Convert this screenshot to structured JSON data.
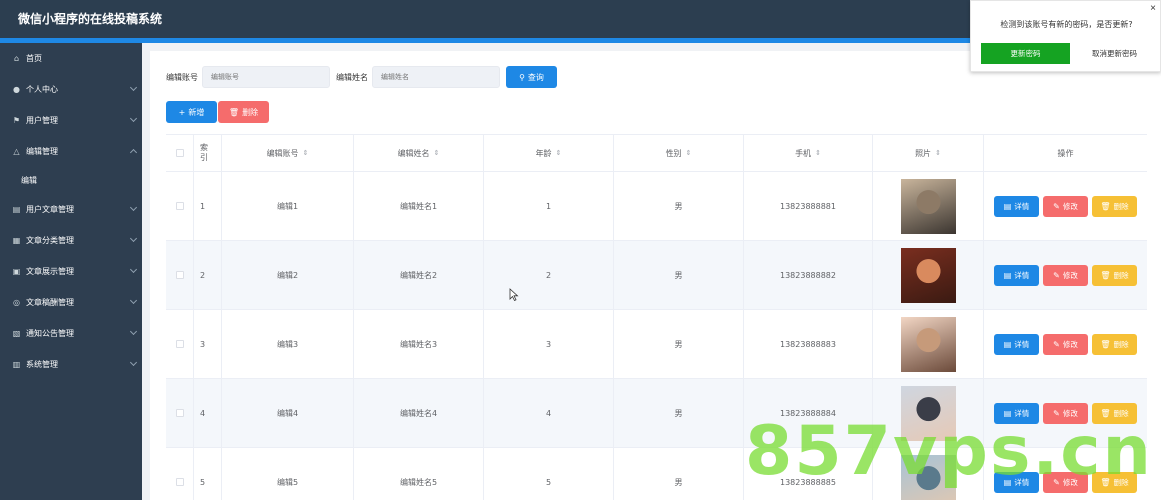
{
  "app": {
    "title": "微信小程序的在线投稿系统"
  },
  "sidebar": {
    "items": [
      {
        "label": "首页",
        "icon": "home-icon",
        "glyph": "⌂",
        "has_arrow": false
      },
      {
        "label": "个人中心",
        "icon": "user-icon",
        "glyph": "●",
        "has_arrow": true
      },
      {
        "label": "用户管理",
        "icon": "flag-icon",
        "glyph": "⚑",
        "has_arrow": true
      },
      {
        "label": "编辑管理",
        "icon": "bell-icon",
        "glyph": "△",
        "has_arrow": true,
        "expanded": true,
        "children": [
          "编辑"
        ]
      },
      {
        "label": "用户文章管理",
        "icon": "document-icon",
        "glyph": "▤",
        "has_arrow": true
      },
      {
        "label": "文章分类管理",
        "icon": "grid-icon",
        "glyph": "▦",
        "has_arrow": true
      },
      {
        "label": "文章展示管理",
        "icon": "media-icon",
        "glyph": "▣",
        "has_arrow": true
      },
      {
        "label": "文章稿酬管理",
        "icon": "microphone-icon",
        "glyph": "◎",
        "has_arrow": true
      },
      {
        "label": "通知公告管理",
        "icon": "message-icon",
        "glyph": "▧",
        "has_arrow": true
      },
      {
        "label": "系统管理",
        "icon": "building-icon",
        "glyph": "▥",
        "has_arrow": true
      }
    ]
  },
  "search": {
    "account_label": "编辑账号",
    "account_placeholder": "编辑账号",
    "name_label": "编辑姓名",
    "name_placeholder": "编辑姓名",
    "query_button": "查询"
  },
  "toolbar": {
    "add_button": "新增",
    "delete_button": "删除"
  },
  "table": {
    "headers": {
      "index": "索引",
      "account": "编辑账号",
      "name": "编辑姓名",
      "age": "年龄",
      "sex": "性别",
      "phone": "手机",
      "photo": "照片",
      "actions": "操作"
    },
    "action_labels": {
      "detail": "详情",
      "edit": "修改",
      "delete": "删除"
    },
    "rows": [
      {
        "index": "1",
        "account": "编辑1",
        "name": "编辑姓名1",
        "age": "1",
        "sex": "男",
        "phone": "13823888881",
        "photo_colors": [
          "#c9b59c",
          "#8d7a66",
          "#3b3530"
        ]
      },
      {
        "index": "2",
        "account": "编辑2",
        "name": "编辑姓名2",
        "age": "2",
        "sex": "男",
        "phone": "13823888882",
        "photo_colors": [
          "#7a2e1f",
          "#d98a5e",
          "#3a1a12"
        ]
      },
      {
        "index": "3",
        "account": "编辑3",
        "name": "编辑姓名3",
        "age": "3",
        "sex": "男",
        "phone": "13823888883",
        "photo_colors": [
          "#f2d6c4",
          "#c69a7a",
          "#6b4a3a"
        ]
      },
      {
        "index": "4",
        "account": "编辑4",
        "name": "编辑姓名4",
        "age": "4",
        "sex": "男",
        "phone": "13823888884",
        "photo_colors": [
          "#cfd6e0",
          "#3a3d48",
          "#e6c9b6"
        ]
      },
      {
        "index": "5",
        "account": "编辑5",
        "name": "编辑姓名5",
        "age": "5",
        "sex": "男",
        "phone": "13823888885",
        "photo_colors": [
          "#a7c3d6",
          "#5a7a8c",
          "#e3c8b0"
        ]
      }
    ]
  },
  "popup": {
    "message": "检测到该账号有新的密码，是否更新?",
    "confirm": "更新密码",
    "cancel": "取消更新密码",
    "close": "×"
  },
  "watermark": {
    "text": "857vps.cn"
  },
  "colors": {
    "primary": "#1e88e5",
    "danger": "#f56c6c",
    "warning": "#f6c035",
    "sidebar": "#2e3e50",
    "confirm": "#15a322"
  }
}
